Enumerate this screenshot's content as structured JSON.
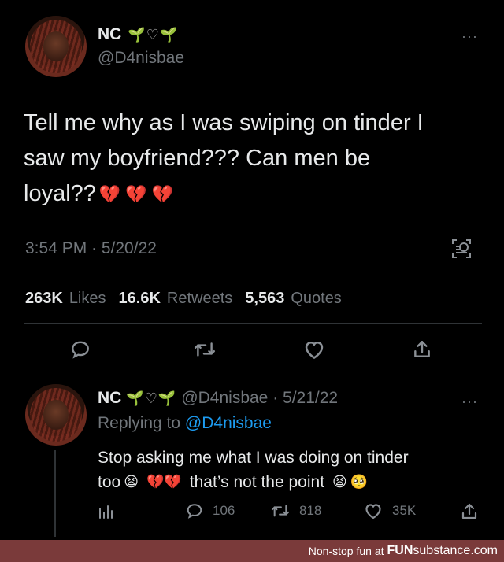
{
  "tweet": {
    "author_name": "NC",
    "author_deco": "🌱♡🌱",
    "handle": "@D4nisbae",
    "text_line1": "Tell me why as I was swiping on tinder I",
    "text_line2": "saw my boyfriend??? Can men be",
    "text_line3": "loyal??",
    "broken_hearts": "💔 💔 💔",
    "time": "3:54 PM · 5/20/22",
    "stats": {
      "likes_num": "263K",
      "likes_label": "Likes",
      "retweets_num": "16.6K",
      "retweets_label": "Retweets",
      "quotes_num": "5,563",
      "quotes_label": "Quotes"
    }
  },
  "reply": {
    "author_name": "NC",
    "author_deco": "🌱♡🌱",
    "handle_date": "@D4nisbae · 5/21/22",
    "replying_prefix": "Replying to ",
    "replying_handle": "@D4nisbae",
    "text_line1": "Stop asking me what I was doing on tinder",
    "text_line2_a": "too",
    "text_line2_b": "that’s not the point",
    "emoji_tired": "😫",
    "emoji_pleading": "🥺",
    "broken_hearts": "💔💔",
    "counts": {
      "replies": "106",
      "retweets": "818",
      "likes": "35K"
    }
  },
  "footer": {
    "prefix": "Non-stop fun at",
    "brand_bold": "FUN",
    "brand_rest": "substance.com"
  },
  "colors": {
    "background": "#000000",
    "muted": "#71767b",
    "link": "#1d9bf0",
    "footer_bg": "#7a3a3a"
  },
  "icons": [
    "more-icon",
    "qr-icon",
    "reply-icon",
    "retweet-icon",
    "like-icon",
    "share-icon",
    "analytics-icon"
  ]
}
